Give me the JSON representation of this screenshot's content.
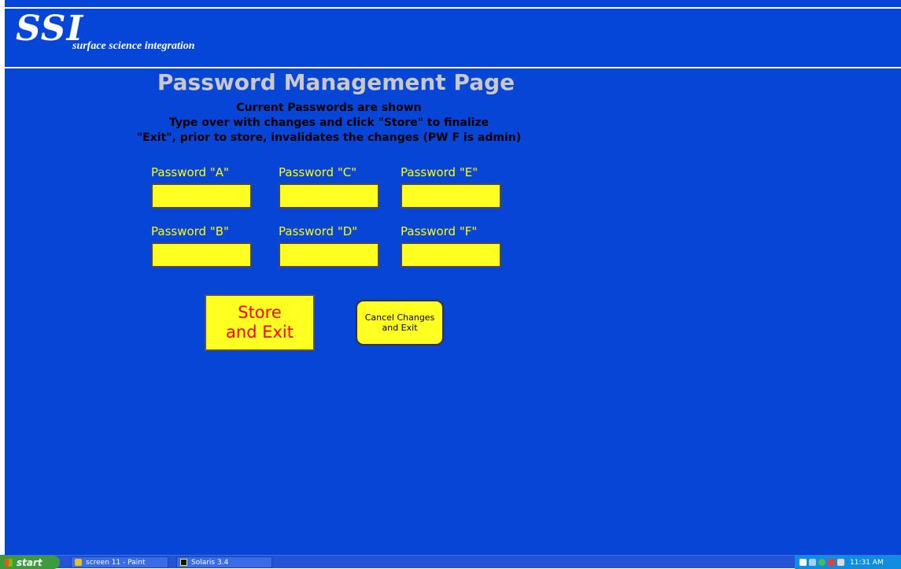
{
  "header": {
    "logo_text": "SSI",
    "tagline": "surface science integration"
  },
  "page": {
    "title": "Password Management Page",
    "instructions": [
      "Current Passwords are shown",
      "Type over with changes and click \"Store\" to finalize",
      "\"Exit\", prior to store, invalidates the changes (PW F is admin)"
    ]
  },
  "passwords": {
    "a": {
      "label": "Password \"A\"",
      "value": ""
    },
    "b": {
      "label": "Password \"B\"",
      "value": ""
    },
    "c": {
      "label": "Password \"C\"",
      "value": ""
    },
    "d": {
      "label": "Password \"D\"",
      "value": ""
    },
    "e": {
      "label": "Password \"E\"",
      "value": ""
    },
    "f": {
      "label": "Password \"F\"",
      "value": ""
    }
  },
  "buttons": {
    "store_line1": "Store",
    "store_line2": "and Exit",
    "cancel_line1": "Cancel Changes",
    "cancel_line2": "and Exit"
  },
  "taskbar": {
    "start_label": "start",
    "items": [
      {
        "label": "screen 11 - Paint",
        "icon": "paint-icon"
      },
      {
        "label": "Solaris 3.4",
        "icon": "solaris-icon"
      }
    ],
    "clock": "11:31 AM"
  },
  "colors": {
    "background": "#0645d6",
    "input_fill": "#ffff22",
    "label_text": "#ffff00",
    "title_text": "#c9c9c9",
    "store_text": "#ff0000"
  }
}
